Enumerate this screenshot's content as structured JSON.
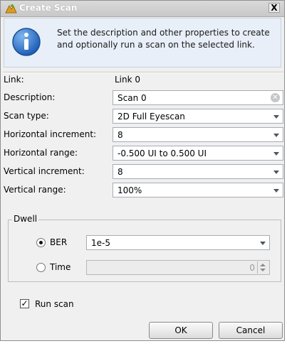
{
  "title": "Create Scan",
  "close_label": "X",
  "banner_text": "Set the description and other properties to create and optionally run a scan on the selected link.",
  "link": {
    "label": "Link:",
    "value": "Link 0"
  },
  "description": {
    "label": "Description:",
    "value": "Scan 0"
  },
  "scan_type": {
    "label": "Scan type:",
    "value": "2D Full Eyescan"
  },
  "horizontal_increment": {
    "label": "Horizontal increment:",
    "value": "8"
  },
  "horizontal_range": {
    "label": "Horizontal range:",
    "value": "-0.500 UI to 0.500 UI"
  },
  "vertical_increment": {
    "label": "Vertical increment:",
    "value": "8"
  },
  "vertical_range": {
    "label": "Vertical range:",
    "value": "100%"
  },
  "dwell": {
    "title": "Dwell",
    "ber": {
      "label": "BER",
      "value": "1e-5",
      "selected": true
    },
    "time": {
      "label": "Time",
      "value": "0",
      "selected": false
    }
  },
  "run_scan": {
    "label": "Run scan",
    "checked": true
  },
  "buttons": {
    "ok": "OK",
    "cancel": "Cancel"
  },
  "colors": {
    "info_icon": "#1f6fc8",
    "app_icon": "#e09d1b"
  }
}
